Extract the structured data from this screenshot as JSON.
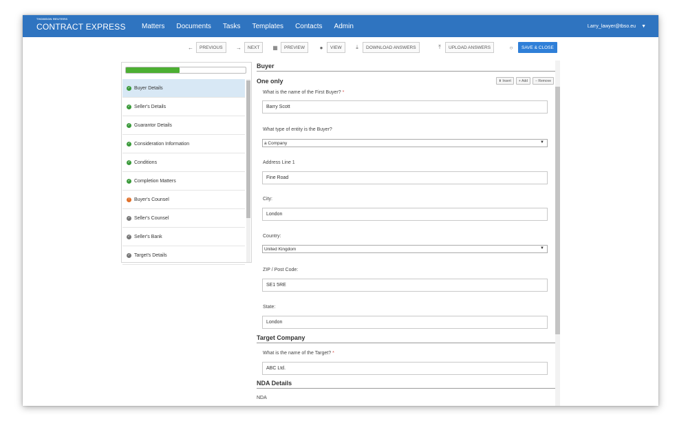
{
  "topbar": {
    "brand_small": "THOMSON REUTERS",
    "brand_main": "CONTRACT EXPRESS",
    "nav": [
      "Matters",
      "Documents",
      "Tasks",
      "Templates",
      "Contacts",
      "Admin"
    ],
    "user": "Larry_lawyer@tbso.eu",
    "color": "#2f74c0"
  },
  "toolbar": {
    "previous": "PREVIOUS",
    "next": "NEXT",
    "preview": "PREVIEW",
    "view": "VIEW",
    "download": "DOWNLOAD ANSWERS",
    "upload": "UPLOAD ANSWERS",
    "save_close": "SAVE & CLOSE",
    "primary_color": "#2f7fd8"
  },
  "sidebar": {
    "progress": 0.45,
    "items": [
      {
        "label": "Buyer Details",
        "status": "complete"
      },
      {
        "label": "Seller's Details",
        "status": "complete"
      },
      {
        "label": "Guarantor Details",
        "status": "complete"
      },
      {
        "label": "Consideration Information",
        "status": "complete"
      },
      {
        "label": "Conditions",
        "status": "complete"
      },
      {
        "label": "Completion Matters",
        "status": "complete"
      },
      {
        "label": "Buyer's Counsel",
        "status": "warning"
      },
      {
        "label": "Seller's Counsel",
        "status": "pending"
      },
      {
        "label": "Seller's Bank",
        "status": "pending"
      },
      {
        "label": "Target's Details",
        "status": "pending"
      }
    ]
  },
  "main": {
    "section_buyer": "Buyer",
    "subsection": "One only",
    "mini_insert": "Insert",
    "mini_add": "Add",
    "mini_remove": "Remove",
    "q_first_buyer": "What is the name of the First Buyer?",
    "first_buyer": "Barry Scott",
    "q_entity_type": "What type of entity is the Buyer?",
    "entity_type": "a Company",
    "q_address": "Address Line 1",
    "address": "Fine Road",
    "q_city": "City:",
    "city": "London",
    "q_country": "Country:",
    "country": "United Kingdom",
    "q_zip": "ZIP / Post Code:",
    "zip": "SE1 5RE",
    "q_state": "State:",
    "state": "London",
    "section_target": "Target Company",
    "q_target": "What is the name of the Target?",
    "target": "ABC Ltd.",
    "section_nda": "NDA Details",
    "nda_label": "NDA"
  }
}
